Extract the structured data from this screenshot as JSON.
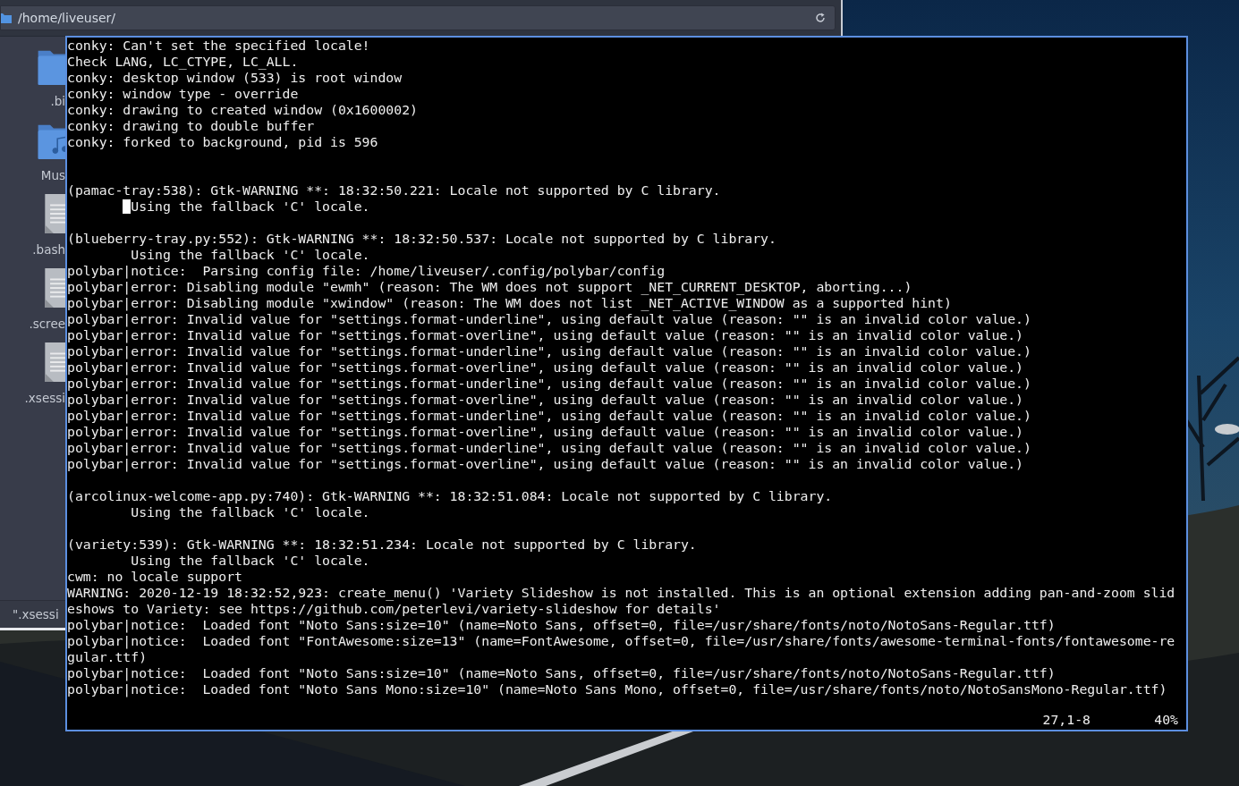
{
  "file_manager": {
    "path": "/home/liveuser/",
    "items": [
      {
        "kind": "folder",
        "label": ".bi"
      },
      {
        "kind": "music",
        "label": "Mus"
      },
      {
        "kind": "document",
        "label": ".bash"
      },
      {
        "kind": "document",
        "label": ".scree"
      },
      {
        "kind": "document",
        "label": ".xsessi"
      }
    ],
    "status": "\".xsessi"
  },
  "terminal": {
    "lines": [
      {
        "kind": "text",
        "text": "conky: Can't set the specified locale!"
      },
      {
        "kind": "text",
        "text": "Check LANG, LC_CTYPE, LC_ALL."
      },
      {
        "kind": "text",
        "text": "conky: desktop window (533) is root window"
      },
      {
        "kind": "text",
        "text": "conky: window type - override"
      },
      {
        "kind": "text",
        "text": "conky: drawing to created window (0x1600002)"
      },
      {
        "kind": "text",
        "text": "conky: drawing to double buffer"
      },
      {
        "kind": "text",
        "text": "conky: forked to background, pid is 596"
      },
      {
        "kind": "blank"
      },
      {
        "kind": "blank"
      },
      {
        "kind": "text",
        "text": "(pamac-tray:538): Gtk-WARNING **: 18:32:50.221: Locale not supported by C library."
      },
      {
        "kind": "cursor",
        "text": "Using the fallback 'C' locale."
      },
      {
        "kind": "blank"
      },
      {
        "kind": "text",
        "text": "(blueberry-tray.py:552): Gtk-WARNING **: 18:32:50.537: Locale not supported by C library."
      },
      {
        "kind": "indented",
        "text": "Using the fallback 'C' locale."
      },
      {
        "kind": "text",
        "text": "polybar|notice:  Parsing config file: /home/liveuser/.config/polybar/config"
      },
      {
        "kind": "text",
        "text": "polybar|error: Disabling module \"ewmh\" (reason: The WM does not support _NET_CURRENT_DESKTOP, aborting...)"
      },
      {
        "kind": "text",
        "text": "polybar|error: Disabling module \"xwindow\" (reason: The WM does not list _NET_ACTIVE_WINDOW as a supported hint)"
      },
      {
        "kind": "text",
        "text": "polybar|error: Invalid value for \"settings.format-underline\", using default value (reason: \"\" is an invalid color value.)"
      },
      {
        "kind": "text",
        "text": "polybar|error: Invalid value for \"settings.format-overline\", using default value (reason: \"\" is an invalid color value.)"
      },
      {
        "kind": "text",
        "text": "polybar|error: Invalid value for \"settings.format-underline\", using default value (reason: \"\" is an invalid color value.)"
      },
      {
        "kind": "text",
        "text": "polybar|error: Invalid value for \"settings.format-overline\", using default value (reason: \"\" is an invalid color value.)"
      },
      {
        "kind": "text",
        "text": "polybar|error: Invalid value for \"settings.format-underline\", using default value (reason: \"\" is an invalid color value.)"
      },
      {
        "kind": "text",
        "text": "polybar|error: Invalid value for \"settings.format-overline\", using default value (reason: \"\" is an invalid color value.)"
      },
      {
        "kind": "text",
        "text": "polybar|error: Invalid value for \"settings.format-underline\", using default value (reason: \"\" is an invalid color value.)"
      },
      {
        "kind": "text",
        "text": "polybar|error: Invalid value for \"settings.format-overline\", using default value (reason: \"\" is an invalid color value.)"
      },
      {
        "kind": "text",
        "text": "polybar|error: Invalid value for \"settings.format-underline\", using default value (reason: \"\" is an invalid color value.)"
      },
      {
        "kind": "text",
        "text": "polybar|error: Invalid value for \"settings.format-overline\", using default value (reason: \"\" is an invalid color value.)"
      },
      {
        "kind": "blank"
      },
      {
        "kind": "text",
        "text": "(arcolinux-welcome-app.py:740): Gtk-WARNING **: 18:32:51.084: Locale not supported by C library."
      },
      {
        "kind": "indented",
        "text": "Using the fallback 'C' locale."
      },
      {
        "kind": "blank"
      },
      {
        "kind": "text",
        "text": "(variety:539): Gtk-WARNING **: 18:32:51.234: Locale not supported by C library."
      },
      {
        "kind": "indented",
        "text": "Using the fallback 'C' locale."
      },
      {
        "kind": "text",
        "text": "cwm: no locale support"
      },
      {
        "kind": "text",
        "text": "WARNING: 2020-12-19 18:32:52,923: create_menu() 'Variety Slideshow is not installed. This is an optional extension adding pan-and-zoom slid"
      },
      {
        "kind": "text",
        "text": "eshows to Variety: see https://github.com/peterlevi/variety-slideshow for details'"
      },
      {
        "kind": "text",
        "text": "polybar|notice:  Loaded font \"Noto Sans:size=10\" (name=Noto Sans, offset=0, file=/usr/share/fonts/noto/NotoSans-Regular.ttf)"
      },
      {
        "kind": "text",
        "text": "polybar|notice:  Loaded font \"FontAwesome:size=13\" (name=FontAwesome, offset=0, file=/usr/share/fonts/awesome-terminal-fonts/fontawesome-re"
      },
      {
        "kind": "text",
        "text": "gular.ttf)"
      },
      {
        "kind": "text",
        "text": "polybar|notice:  Loaded font \"Noto Sans:size=10\" (name=Noto Sans, offset=0, file=/usr/share/fonts/noto/NotoSans-Regular.ttf)"
      },
      {
        "kind": "text",
        "text": "polybar|notice:  Loaded font \"Noto Sans Mono:size=10\" (name=Noto Sans Mono, offset=0, file=/usr/share/fonts/noto/NotoSansMono-Regular.ttf)"
      }
    ],
    "status": {
      "position": "27,1-8",
      "percent": "40%"
    }
  }
}
